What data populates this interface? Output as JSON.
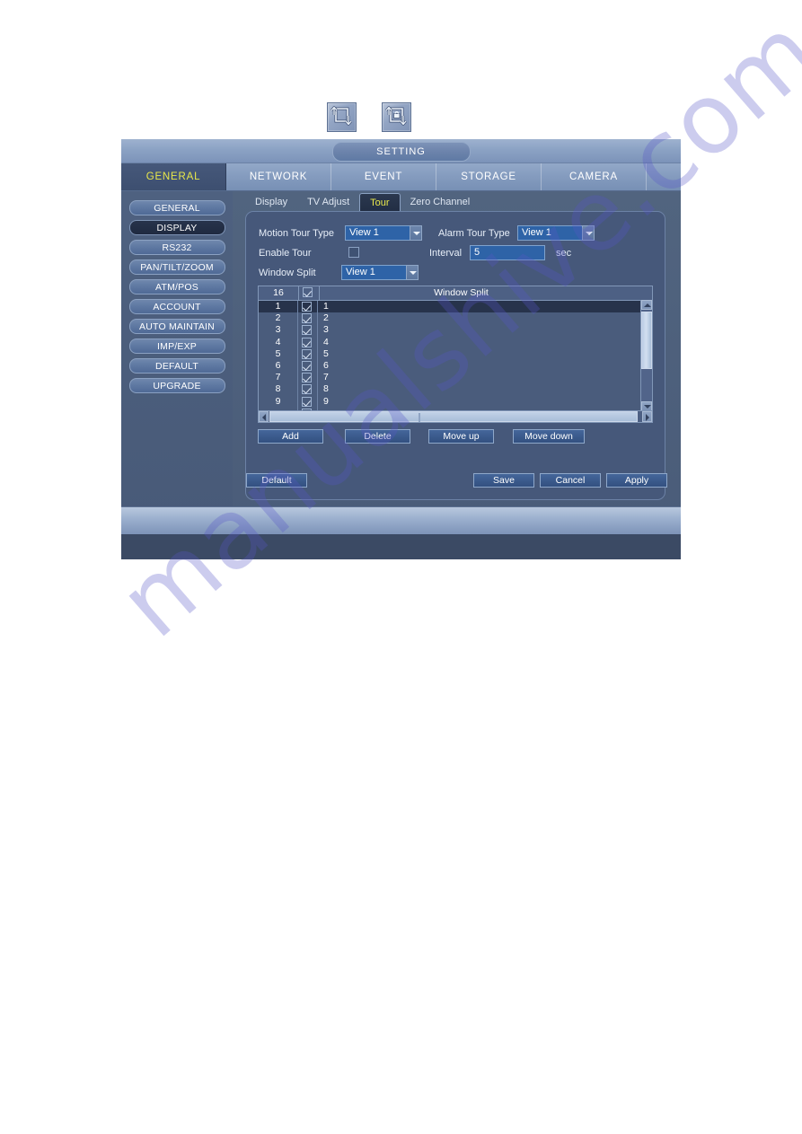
{
  "icons": {
    "tool_1": "rotate-loop-icon",
    "tool_2": "rotate-lock-icon"
  },
  "window": {
    "title": "SETTING"
  },
  "main_tabs": [
    {
      "label": "GENERAL",
      "active": true
    },
    {
      "label": "NETWORK",
      "active": false
    },
    {
      "label": "EVENT",
      "active": false
    },
    {
      "label": "STORAGE",
      "active": false
    },
    {
      "label": "CAMERA",
      "active": false
    }
  ],
  "sidebar": {
    "items": [
      {
        "label": "GENERAL",
        "active": false
      },
      {
        "label": "DISPLAY",
        "active": true
      },
      {
        "label": "RS232",
        "active": false
      },
      {
        "label": "PAN/TILT/ZOOM",
        "active": false
      },
      {
        "label": "ATM/POS",
        "active": false
      },
      {
        "label": "ACCOUNT",
        "active": false
      },
      {
        "label": "AUTO MAINTAIN",
        "active": false
      },
      {
        "label": "IMP/EXP",
        "active": false
      },
      {
        "label": "DEFAULT",
        "active": false
      },
      {
        "label": "UPGRADE",
        "active": false
      }
    ]
  },
  "sub_tabs": [
    {
      "label": "Display",
      "active": false
    },
    {
      "label": "TV Adjust",
      "active": false
    },
    {
      "label": "Tour",
      "active": true
    },
    {
      "label": "Zero Channel",
      "active": false
    }
  ],
  "form": {
    "motion_tour_type": {
      "label": "Motion Tour Type",
      "value": "View 1"
    },
    "alarm_tour_type": {
      "label": "Alarm Tour Type",
      "value": "View 1"
    },
    "enable_tour": {
      "label": "Enable Tour",
      "checked": false
    },
    "interval": {
      "label": "Interval",
      "value": "5",
      "unit": "sec"
    },
    "window_split": {
      "label": "Window Split",
      "value": "View 1"
    }
  },
  "list": {
    "header": {
      "count": "16",
      "title": "Window Split"
    },
    "rows": [
      {
        "num": "1",
        "checked": true,
        "value": "1",
        "selected": true
      },
      {
        "num": "2",
        "checked": true,
        "value": "2",
        "selected": false
      },
      {
        "num": "3",
        "checked": true,
        "value": "3",
        "selected": false
      },
      {
        "num": "4",
        "checked": true,
        "value": "4",
        "selected": false
      },
      {
        "num": "5",
        "checked": true,
        "value": "5",
        "selected": false
      },
      {
        "num": "6",
        "checked": true,
        "value": "6",
        "selected": false
      },
      {
        "num": "7",
        "checked": true,
        "value": "7",
        "selected": false
      },
      {
        "num": "8",
        "checked": true,
        "value": "8",
        "selected": false
      },
      {
        "num": "9",
        "checked": true,
        "value": "9",
        "selected": false
      }
    ]
  },
  "buttons": {
    "add": "Add",
    "delete": "Delete",
    "move_up": "Move up",
    "move_down": "Move down",
    "default": "Default",
    "save": "Save",
    "cancel": "Cancel",
    "apply": "Apply"
  },
  "watermark": {
    "text": "manualshive.com"
  },
  "colors": {
    "accent_yellow": "#e9e84a",
    "input_blue": "#2e63a7",
    "panel_blue": "#46587a",
    "titlebar_blue": "#8ba2c4"
  }
}
